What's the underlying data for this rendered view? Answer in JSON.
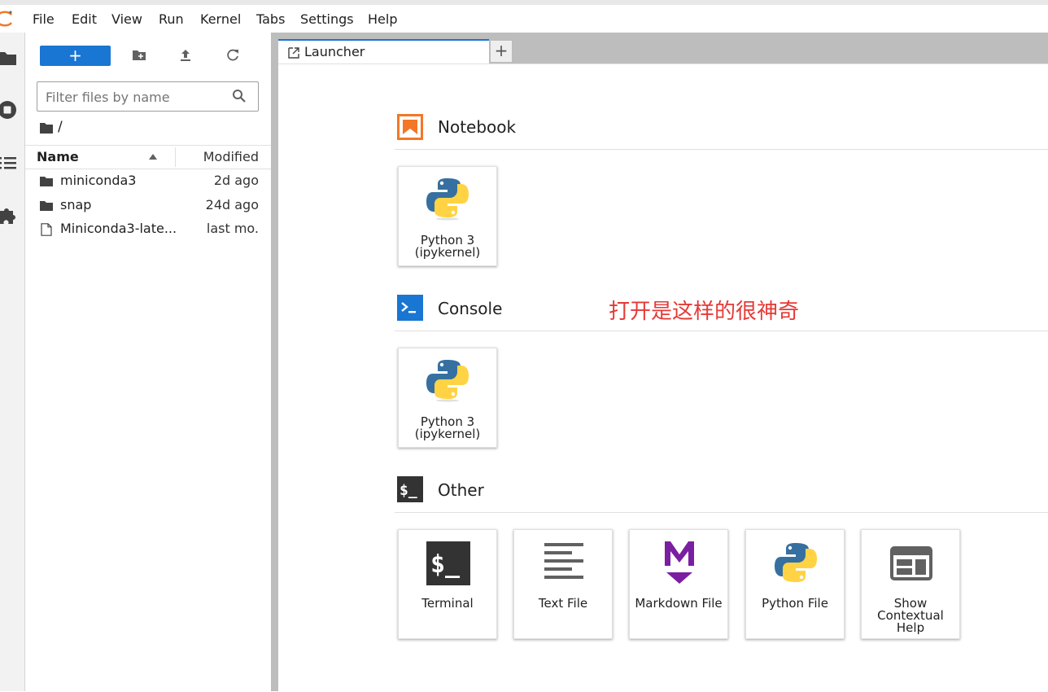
{
  "menubar": {
    "items": [
      "File",
      "Edit",
      "View",
      "Run",
      "Kernel",
      "Tabs",
      "Settings",
      "Help"
    ]
  },
  "filebrowser": {
    "new_label": "+",
    "filter_placeholder": "Filter files by name",
    "breadcrumb": "/",
    "columns": {
      "name": "Name",
      "modified": "Modified"
    },
    "files": [
      {
        "name": "miniconda3",
        "type": "folder",
        "modified": "2d ago"
      },
      {
        "name": "snap",
        "type": "folder",
        "modified": "24d ago"
      },
      {
        "name": "Miniconda3-late...",
        "type": "file",
        "modified": "last mo."
      }
    ]
  },
  "tabs": {
    "items": [
      {
        "label": "Launcher"
      }
    ],
    "add_label": "+"
  },
  "launcher": {
    "sections": [
      {
        "title": "Notebook",
        "cards": [
          {
            "label_line1": "Python 3",
            "label_line2": "(ipykernel)"
          }
        ]
      },
      {
        "title": "Console",
        "cards": [
          {
            "label_line1": "Python 3",
            "label_line2": "(ipykernel)"
          }
        ]
      },
      {
        "title": "Other",
        "cards": [
          {
            "label": "Terminal"
          },
          {
            "label": "Text File"
          },
          {
            "label": "Markdown File"
          },
          {
            "label": "Python File"
          },
          {
            "label_line1": "Show",
            "label_line2": "Contextual",
            "label_line3": "Help"
          }
        ]
      }
    ]
  },
  "annotation": "打开是这样的很神奇",
  "colors": {
    "accent": "#1976d2",
    "notebook_orange": "#f37726",
    "console_blue": "#0d47a1",
    "markdown_purple": "#7b1fa2",
    "annotation_red": "#e53935"
  }
}
